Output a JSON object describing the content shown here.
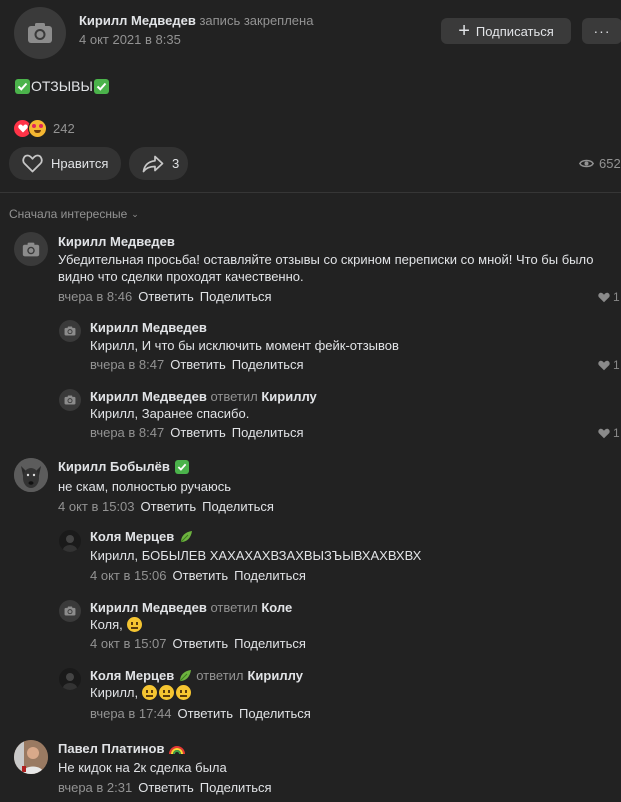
{
  "post": {
    "author": "Кирилл Медведев",
    "pinned_note": "запись закреплена",
    "date": "4 окт 2021 в 8:35",
    "subscribe_label": "Подписаться",
    "more_label": "···",
    "text": "ОТЗЫВЫ",
    "reactions_count": "242",
    "like_label": "Нравится",
    "share_count": "3",
    "views": "652"
  },
  "sort_label": "Сначала интересные",
  "comments": [
    {
      "author": "Кирилл Медведев",
      "text": "Убедительная просьба! оставляйте отзывы со скрином переписки со мной! Что бы было видно что сделки проходят качественно.",
      "time": "вчера в 8:46",
      "reply": "Ответить",
      "share": "Поделиться",
      "likes": "1",
      "replies": [
        {
          "author": "Кирилл Медведев",
          "text": "Кирилл, И что бы исключить момент фейк-отзывов",
          "time": "вчера в 8:47",
          "reply": "Ответить",
          "share": "Поделиться",
          "likes": "1"
        },
        {
          "author": "Кирилл Медведев",
          "replied_word": "ответил",
          "replied_to": "Кириллу",
          "text": "Кирилл, Заранее спасибо.",
          "time": "вчера в 8:47",
          "reply": "Ответить",
          "share": "Поделиться",
          "likes": "1"
        }
      ]
    },
    {
      "author": "Кирилл Бобылёв",
      "text": "не скам, полностью ручаюсь",
      "time": "4 окт в 15:03",
      "reply": "Ответить",
      "share": "Поделиться",
      "replies": [
        {
          "author": "Коля Мерцев",
          "text": "Кирилл, БОБЫЛЕВ ХАХАХАХВЗАХВЫЗЪЫВХАХВХВХ",
          "time": "4 окт в 15:06",
          "reply": "Ответить",
          "share": "Поделиться"
        },
        {
          "author": "Кирилл Медведев",
          "replied_word": "ответил",
          "replied_to": "Коле",
          "text": "Коля,",
          "time": "4 окт в 15:07",
          "reply": "Ответить",
          "share": "Поделиться"
        },
        {
          "author": "Коля Мерцев",
          "replied_word": "ответил",
          "replied_to": "Кириллу",
          "text": "Кирилл,",
          "time": "вчера в 17:44",
          "reply": "Ответить",
          "share": "Поделиться"
        }
      ]
    },
    {
      "author": "Павел Платинов",
      "text": "Не кидок на 2к сделка была",
      "time": "вчера в 2:31",
      "reply": "Ответить",
      "share": "Поделиться"
    }
  ],
  "colors": {
    "background": "#222222",
    "button": "#3a3a3a",
    "muted_text": "#939393",
    "check_green": "#4bb34b",
    "heart_red": "#ff3347"
  }
}
